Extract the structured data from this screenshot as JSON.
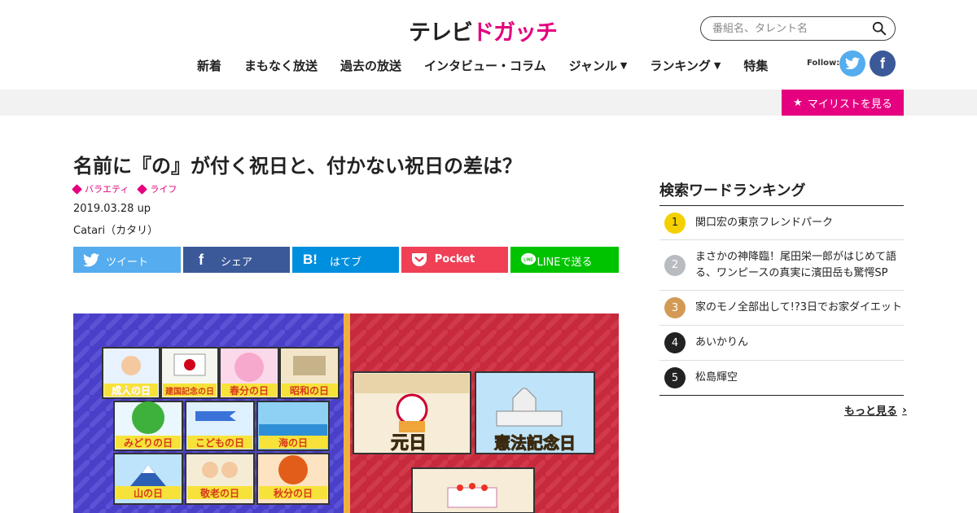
{
  "header": {
    "logo_part1": "テレビ",
    "logo_part2": "ドガッチ",
    "search_placeholder": "番組名、タレント名",
    "nav": [
      {
        "label": "新着"
      },
      {
        "label": "まもなく放送"
      },
      {
        "label": "過去の放送"
      },
      {
        "label": "インタビュー・コラム"
      },
      {
        "label": "ジャンル",
        "has_caret": true
      },
      {
        "label": "ランキング",
        "has_caret": true
      },
      {
        "label": "特集"
      }
    ],
    "follow_label": "Follow:",
    "mylist_label": "マイリストを見る"
  },
  "article": {
    "title": "名前に『の』が付く祝日と、付かない祝日の差は？",
    "tags": [
      "バラエティ",
      "ライフ"
    ],
    "date": "2019.03.28 up",
    "author": "Catari（カタリ）",
    "share": {
      "twitter": "ツイート",
      "facebook": "シェア",
      "hatena_icon": "B!",
      "hatena": "はてブ",
      "pocket": "Pocket",
      "line": "LINEで送る",
      "line_icon": "LINE"
    },
    "hero_labels": {
      "left": [
        "成人の日",
        "建国記念の日",
        "春分の日",
        "昭和の日",
        "みどりの日",
        "こどもの日",
        "海の日",
        "山の日",
        "敬老の日",
        "秋分の日"
      ],
      "right": [
        "元日",
        "憲法記念日"
      ]
    }
  },
  "ranking": {
    "title": "検索ワードランキング",
    "items": [
      {
        "rank": "1",
        "text": "関口宏の東京フレンドパーク",
        "color": "#f5d000"
      },
      {
        "rank": "2",
        "text_line1": "まさかの神降臨！尾田栄一郎がはじめて語",
        "text_line2": "る、ワンピースの真実に濱田岳も驚愕SP",
        "color": "#b8bcc0"
      },
      {
        "rank": "3",
        "text": "家のモノ全部出して!?3日でお家ダイエット",
        "color": "#d49a55"
      },
      {
        "rank": "4",
        "text": "あいかりん",
        "color": "#222222"
      },
      {
        "rank": "5",
        "text": "松島輝空",
        "color": "#222222"
      }
    ],
    "more_label": "もっと見る"
  },
  "colors": {
    "accent": "#e4007f",
    "twitter": "#55acee",
    "facebook": "#3b5998",
    "hatena": "#008fde",
    "pocket": "#ef4056",
    "line": "#00c300"
  }
}
